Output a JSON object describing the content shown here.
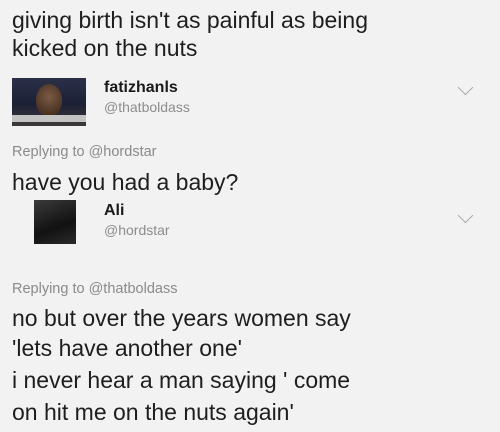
{
  "post": {
    "line1": "giving birth isn't as painful as being",
    "line2": "kicked on the nuts"
  },
  "reply1": {
    "display_name": "fatizhanls",
    "handle": "@thatboldass",
    "replying_prefix": "Replying to",
    "replying_to": "@hordstar",
    "text": "have you had a baby?"
  },
  "reply2": {
    "display_name": "Ali",
    "handle": "@hordstar",
    "replying_prefix": "Replying to",
    "replying_to": "@thatboldass",
    "line1": "no but over the years women say",
    "line2": "'lets have another one'",
    "line3": "i never hear a man saying ' come",
    "line4": "on hit me on the nuts again'"
  },
  "icons": {
    "menu_chevron": "chevron-down-icon"
  },
  "colors": {
    "background": "#f2f2f2",
    "text": "#1e1e1e",
    "muted": "#8a8a8a"
  }
}
